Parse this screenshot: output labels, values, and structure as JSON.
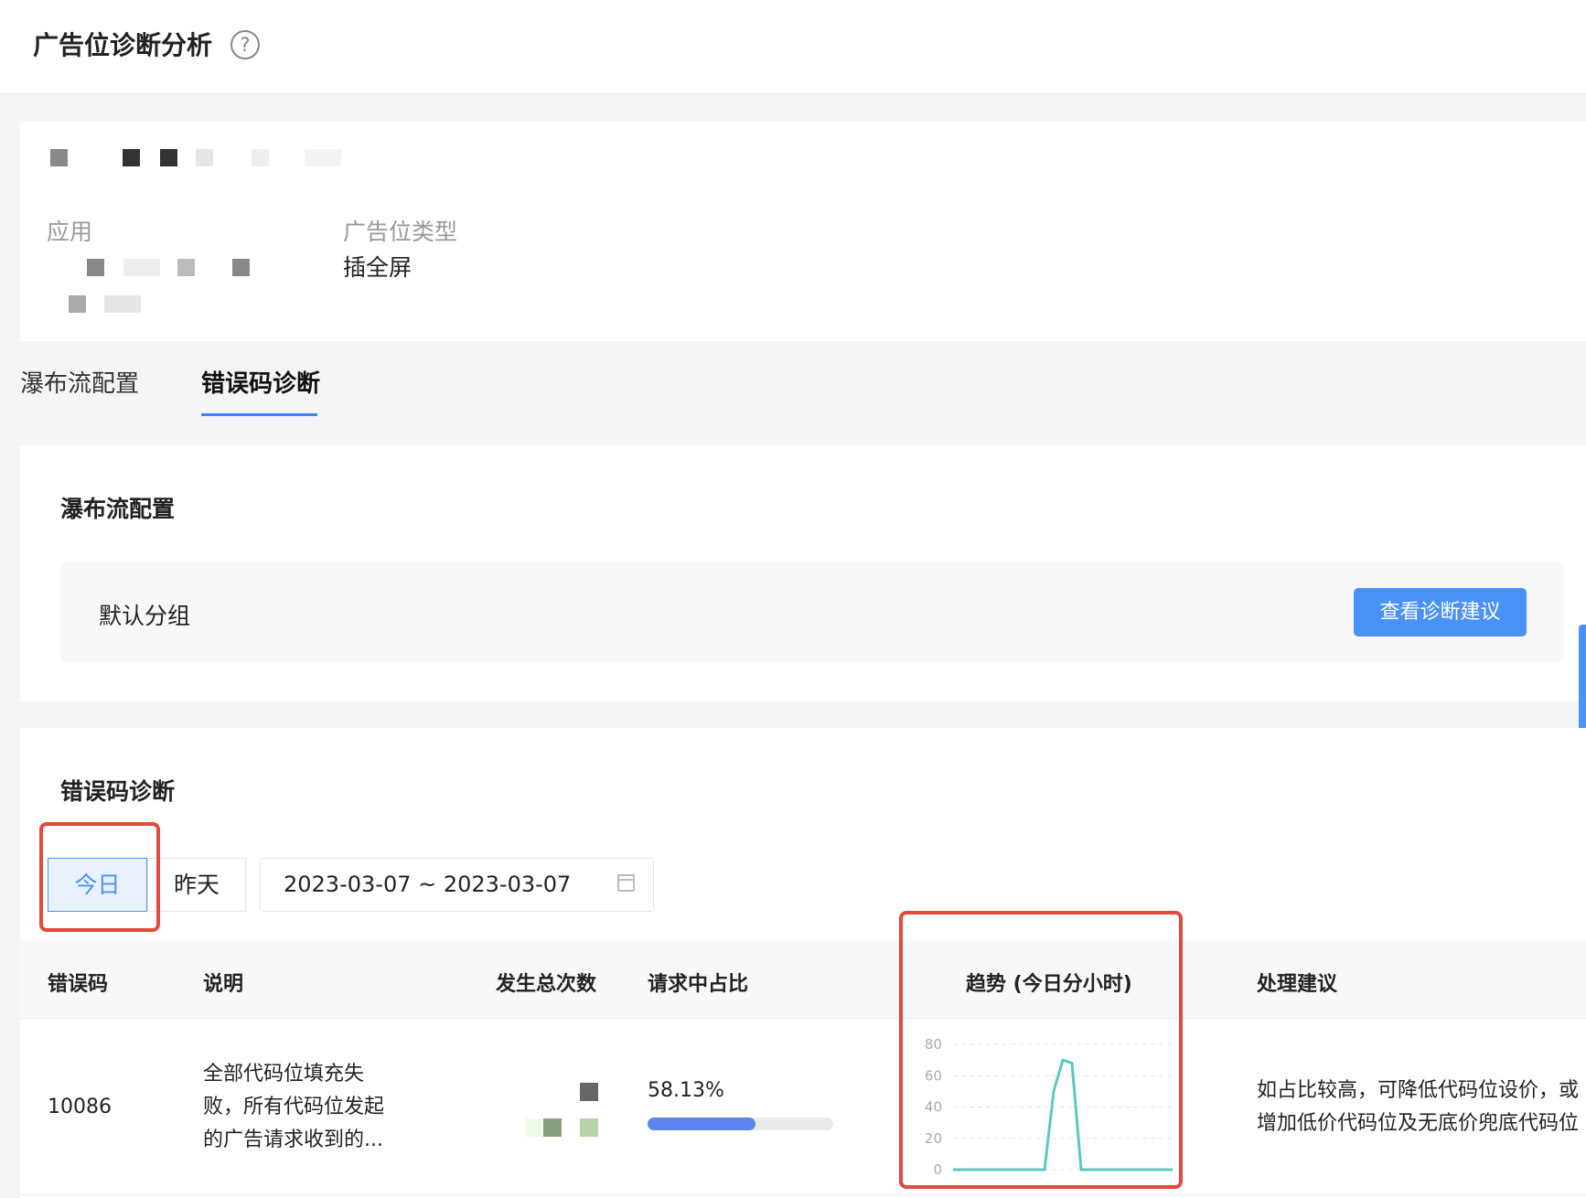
{
  "header": {
    "title": "广告位诊断分析",
    "help_icon": "question-circle-icon"
  },
  "info": {
    "app_label": "应用",
    "ad_type_label": "广告位类型",
    "ad_type_value": "插全屏"
  },
  "tabs": [
    {
      "label": "瀑布流配置",
      "active": false
    },
    {
      "label": "错误码诊断",
      "active": true
    }
  ],
  "waterfall": {
    "title": "瀑布流配置",
    "group_label": "默认分组",
    "button_label": "查看诊断建议"
  },
  "error_diag": {
    "title": "错误码诊断",
    "today_label": "今日",
    "yesterday_label": "昨天",
    "date_range": "2023-03-07 ~ 2023-03-07",
    "columns": [
      "错误码",
      "说明",
      "发生总次数",
      "请求中占比",
      "趋势 (今日分小时)",
      "处理建议"
    ],
    "rows": [
      {
        "code": "10086",
        "desc": "全部代码位填充失败，所有代码位发起的广告请求收到的...",
        "ratio": "58.13%",
        "ratio_fraction": 0.5813,
        "suggestion": "如占比较高，可降低代码位设价，或增加低价代码位及无底价兜底代码位"
      }
    ]
  },
  "trend_chart": {
    "type": "line",
    "y_ticks": [
      "0",
      "20",
      "40",
      "60",
      "80"
    ],
    "ylim": [
      0,
      80
    ],
    "grid": true,
    "color": "#5ec7c0",
    "values": [
      0,
      0,
      0,
      0,
      0,
      0,
      0,
      0,
      0,
      0,
      0,
      50,
      70,
      68,
      0,
      0,
      0,
      0,
      0,
      0,
      0,
      0,
      0,
      0,
      0
    ]
  },
  "colors": {
    "accent": "#4b92f8",
    "highlight": "#e24a3b"
  }
}
